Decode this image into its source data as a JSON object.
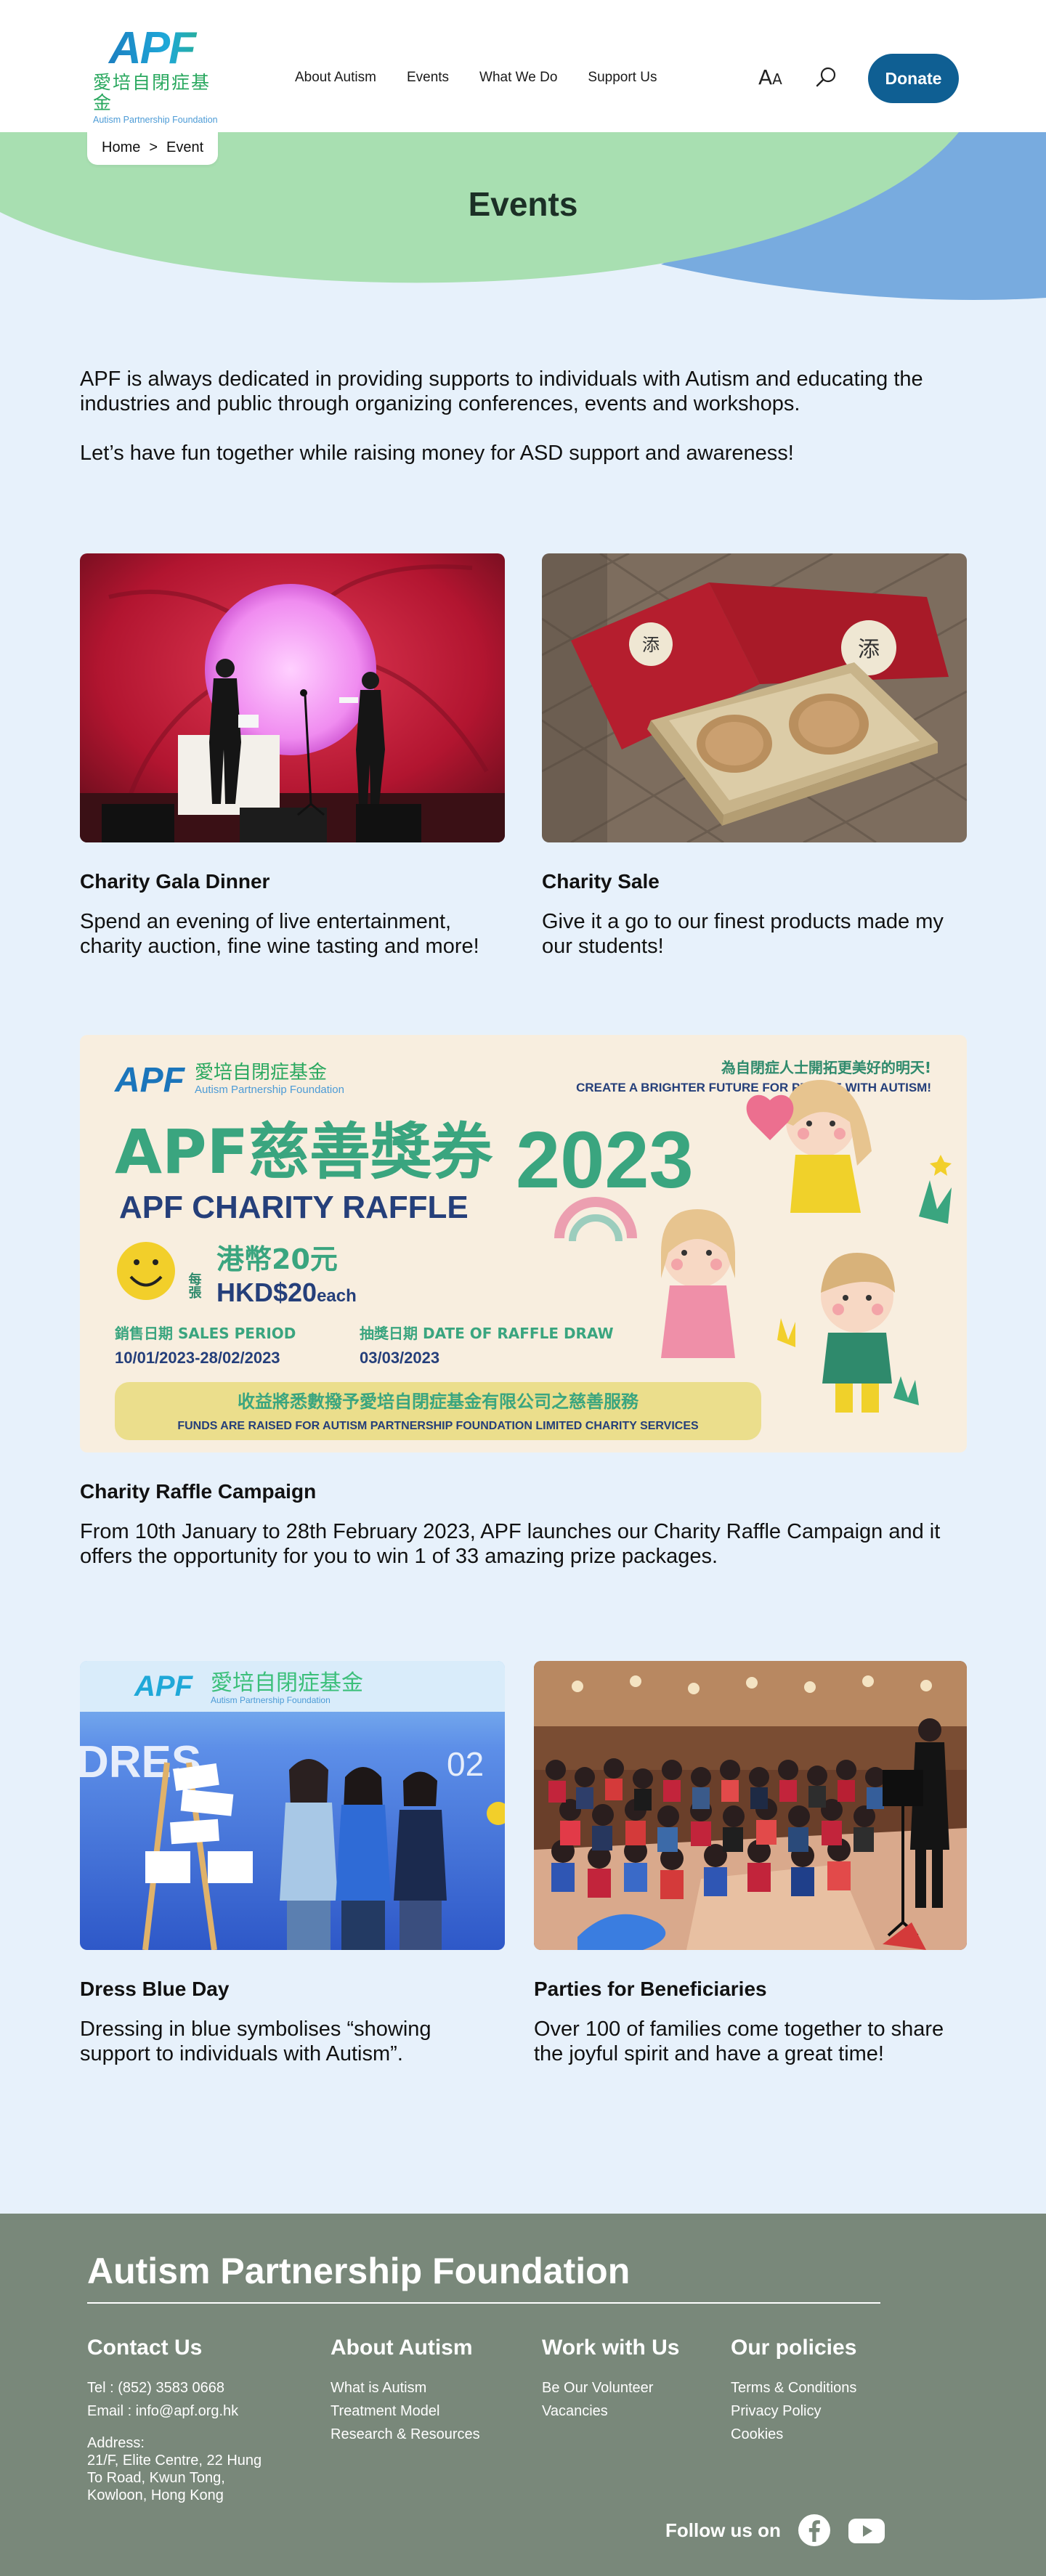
{
  "header": {
    "logo": {
      "en": "APF",
      "zh": "愛培自閉症基金",
      "sub": "Autism Partnership Foundation"
    },
    "nav": [
      {
        "label": "About Autism"
      },
      {
        "label": "Events"
      },
      {
        "label": "What We Do"
      },
      {
        "label": "Support Us"
      }
    ],
    "font_size_label_big": "A",
    "font_size_label_small": "A",
    "donate_label": "Donate"
  },
  "breadcrumb": {
    "home": "Home",
    "separator": ">",
    "current": "Event"
  },
  "page_title": "Events",
  "intro": {
    "p1": "APF is always dedicated in providing supports to individuals with Autism and educating the industries and public through organizing conferences, events and workshops.",
    "p2": "Let’s have fun together while raising money for ASD support and awareness!"
  },
  "events": [
    {
      "title": "Charity Gala Dinner",
      "description": "Spend an evening of live entertainment, charity auction, fine wine tasting and more!"
    },
    {
      "title": "Charity Sale",
      "description": "Give it a go to our finest products made my our students!"
    },
    {
      "title": "Charity Raffle Campaign",
      "description": "From 10th January to 28th February 2023, APF launches our Charity Raffle Campaign and it offers the opportunity for you to win 1 of 33 amazing prize packages."
    },
    {
      "title": "Dress Blue Day",
      "description": "Dressing in blue symbolises “showing support to individuals with Autism”."
    },
    {
      "title": "Parties for Beneficiaries",
      "description": "Over 100 of families come together to share the joyful spirit and have a great time!"
    }
  ],
  "raffle_poster": {
    "logo_en": "APF",
    "logo_zh": "愛培自閉症基金",
    "logo_sub": "Autism Partnership Foundation",
    "tagline_zh": "為自閉症人士開拓更美好的明天!",
    "tagline_en": "CREATE A BRIGHTER FUTURE FOR PEOPLE WITH AUTISM!",
    "title_zh": "APF慈善獎券",
    "year": "2023",
    "title_en": "APF CHARITY RAFFLE",
    "price_each_zh": "每張",
    "price_zh": "港幣20元",
    "price_en": "HKD$20",
    "price_each_en": "each",
    "sales_label": "銷售日期  SALES PERIOD",
    "sales_dates": "10/01/2023-28/02/2023",
    "draw_label": "抽獎日期  DATE OF RAFFLE DRAW",
    "draw_date": "03/03/2023",
    "funds_zh": "收益將悉數撥予愛培自閉症基金有限公司之慈善服務",
    "funds_en": "FUNDS ARE RAISED FOR AUTISM PARTNERSHIP FOUNDATION LIMITED CHARITY SERVICES"
  },
  "dress_blue_photo": {
    "banner_en": "APF",
    "banner_zh": "愛培自閉症基金",
    "banner_sub": "Autism Partnership Foundation",
    "banner_text": "DRES",
    "banner_date": "02"
  },
  "footer": {
    "org_name": "Autism Partnership Foundation",
    "contact": {
      "heading": "Contact Us",
      "tel": "Tel : (852) 3583 0668",
      "email": "Email : info@apf.org.hk",
      "address_label": "Address:",
      "address_lines": [
        "21/F, Elite Centre, 22 Hung",
        "To Road, Kwun Tong,",
        "Kowloon, Hong Kong"
      ]
    },
    "about": {
      "heading": "About Autism",
      "links": [
        "What is Autism",
        "Treatment Model",
        "Research & Resources"
      ]
    },
    "work": {
      "heading": "Work with Us",
      "links": [
        "Be Our Volunteer",
        "Vacancies"
      ]
    },
    "policies": {
      "heading": "Our policies",
      "links": [
        "Terms & Conditions",
        "Privacy Policy",
        "Cookies"
      ]
    },
    "follow_label": "Follow us on"
  },
  "colors": {
    "page_bg": "#e7f1fb",
    "donate": "#0f5f93",
    "hero_green": "#a8dfb1",
    "hero_blue": "#78abdf",
    "footer": "#79887a"
  }
}
